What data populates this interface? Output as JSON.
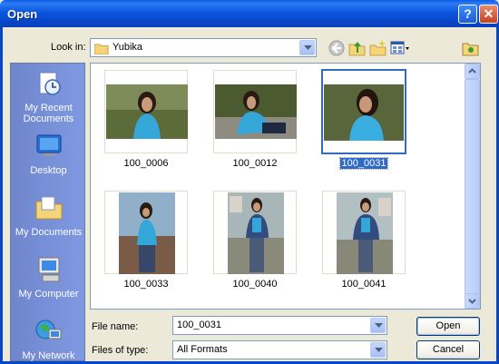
{
  "window": {
    "title": "Open"
  },
  "lookin": {
    "label": "Look in:",
    "value": "Yubika"
  },
  "places": [
    {
      "label": "My Recent Documents",
      "icon": "recent-documents-icon"
    },
    {
      "label": "Desktop",
      "icon": "desktop-icon"
    },
    {
      "label": "My Documents",
      "icon": "my-documents-icon"
    },
    {
      "label": "My Computer",
      "icon": "my-computer-icon"
    },
    {
      "label": "My Network",
      "icon": "my-network-icon"
    }
  ],
  "files": [
    {
      "name": "100_0006",
      "selected": false
    },
    {
      "name": "100_0012",
      "selected": false
    },
    {
      "name": "100_0031",
      "selected": true
    },
    {
      "name": "100_0033",
      "selected": false
    },
    {
      "name": "100_0040",
      "selected": false
    },
    {
      "name": "100_0041",
      "selected": false
    }
  ],
  "filename": {
    "label": "File name:",
    "value": "100_0031"
  },
  "filetype": {
    "label": "Files of type:",
    "value": "All Formats"
  },
  "buttons": {
    "open": "Open",
    "cancel": "Cancel"
  },
  "colors": {
    "selection": "#316ac5",
    "titlebar": "#0a56dd"
  }
}
